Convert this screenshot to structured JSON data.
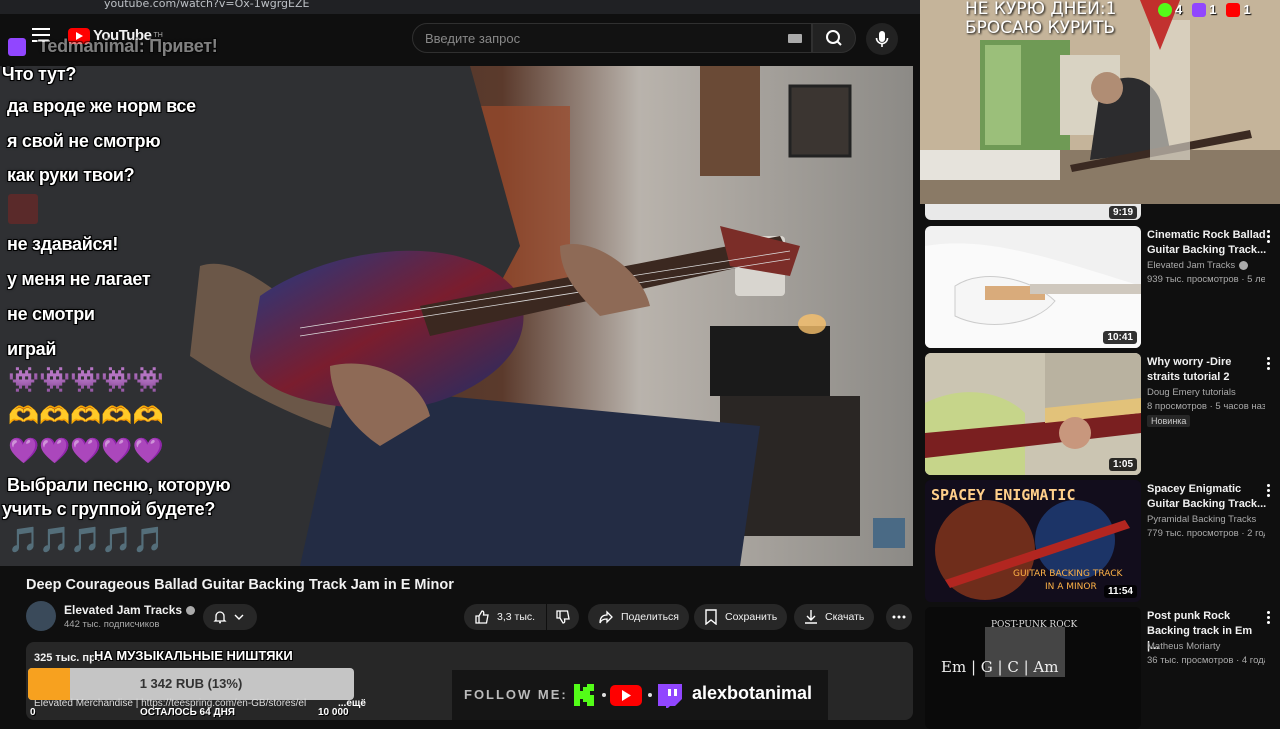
{
  "browser": {
    "url": "youtube.com/watch?v=Ox-1wgrgEZE"
  },
  "header": {
    "logo_text": "YouTube",
    "logo_sup": "TH",
    "search_placeholder": "Введите запрос"
  },
  "chat": {
    "top_line_partial": "Tedmanimal: Привет!",
    "messages": [
      "Что тут?",
      "да вроде же норм все",
      "я свой не смотрю",
      "как руки твои?",
      "не здавайся!",
      "у меня не лагает",
      "не смотри",
      "играй",
      "Выбрали песню, которую",
      "учить с группой будете?"
    ],
    "emotes": {
      "row1": "👾👾👾👾👾",
      "row2": "🫶🫶🫶🫶🫶",
      "row3": "💜💜💜💜💜",
      "row4": "🎵🎵🎵🎵🎵"
    }
  },
  "video": {
    "title": "Deep Courageous Ballad Guitar Backing Track Jam in E Minor",
    "channel": "Elevated Jam Tracks",
    "subscribers": "442 тыс. подписчиков",
    "likes": "3,3 тыс.",
    "share_label": "Поделиться",
    "save_label": "Сохранить",
    "download_label": "Скачать",
    "views_partial": "325 тыс. про",
    "merch_line": "Elevated Merchandise | https://teespring.com/en-GB/stores/el",
    "more_label": "...ещё"
  },
  "stream_overlay": {
    "counter_line1": "НЕ КУРЮ ДНЕЙ:1",
    "counter_line2": "БРОСАЮ КУРИТЬ",
    "stats": [
      {
        "platform": "kick",
        "count": "4",
        "color": "#53fc18"
      },
      {
        "platform": "twitch",
        "count": "1",
        "color": "#9146ff"
      },
      {
        "platform": "youtube",
        "count": "1",
        "color": "#ff0000"
      }
    ],
    "goal": {
      "title": "НА МУЗЫКАЛЬНЫЕ НИШТЯКИ",
      "amount": "1 342 RUB (13%)",
      "percent": 13,
      "min": "0",
      "remaining": "ОСТАЛОСЬ 64 ДНЯ",
      "max": "10 000",
      "color": "#f7a11f"
    },
    "follow": {
      "label": "FOLLOW ME:",
      "username": "alexbotanimal"
    }
  },
  "sidebar": {
    "first_duration": "9:19",
    "items": [
      {
        "title": "Cinematic Rock Ballad Guitar Backing Track...",
        "channel": "Elevated Jam Tracks",
        "meta": "939 тыс. просмотров · 5 ле...",
        "duration": "10:41",
        "badge": ""
      },
      {
        "title": "Why worry -Dire straits tutorial 2",
        "channel": "Doug Emery tutorials",
        "meta": "8 просмотров · 5 часов наз...",
        "duration": "1:05",
        "badge": "Новинка"
      },
      {
        "title": "Spacey Enigmatic Guitar Backing Track...",
        "channel": "Pyramidal Backing Tracks",
        "meta": "779 тыс. просмотров · 2 год...",
        "duration": "11:54",
        "badge": ""
      },
      {
        "title": "Post punk Rock Backing track in Em |...",
        "channel": "Matheus Moriarty",
        "meta": "36 тыс. просмотров · 4 года...",
        "duration": "",
        "badge": ""
      }
    ],
    "thumb_texts": {
      "spacey": "SPACEY ENIGMATIC",
      "spacey_sub": "GUITAR BACKING TRACK",
      "spacey_sub2": "IN A MINOR",
      "postpunk": "POST-PUNK ROCK",
      "postpunk_chords": "Em | G | C | Am"
    }
  }
}
